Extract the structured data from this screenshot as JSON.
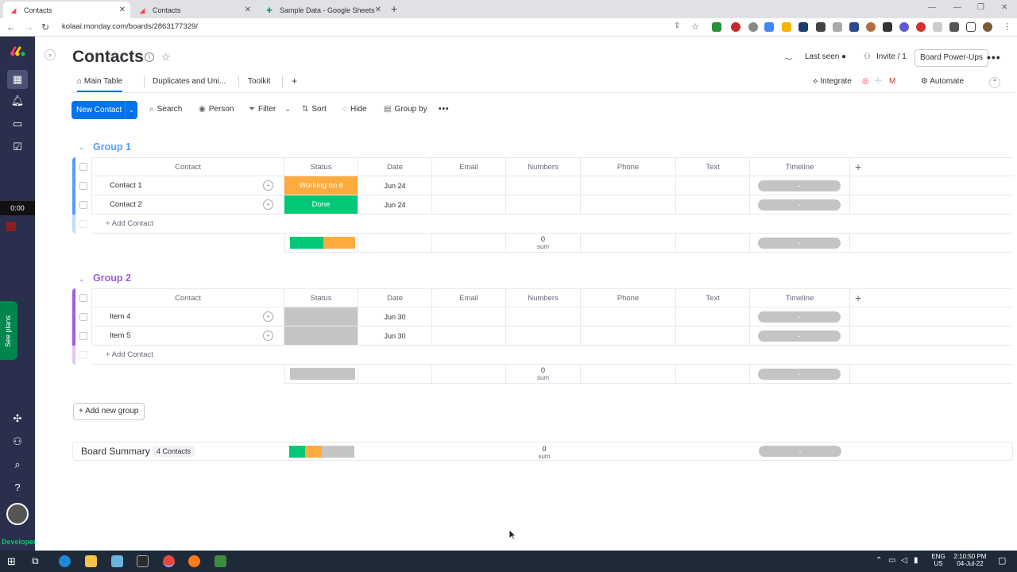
{
  "browser": {
    "tabs": [
      {
        "label": "Contacts",
        "active": true
      },
      {
        "label": "Contacts",
        "active": false
      },
      {
        "label": "Sample Data - Google Sheets",
        "active": false
      }
    ],
    "url": "kolaai.monday.com/boards/2863177329/"
  },
  "sidebar": {
    "timer": "0:00",
    "see_plans": "See plans",
    "developer": "Developer"
  },
  "board": {
    "title": "Contacts",
    "last_seen": "Last seen",
    "invite": "Invite / 1",
    "power_ups": "Board Power-Ups",
    "views": [
      "Main Table",
      "Duplicates and Uni...",
      "Toolkit"
    ],
    "add_view": "+",
    "integrate": "Integrate",
    "automate": "Automate"
  },
  "toolbar": {
    "new_item": "New Contact",
    "search": "Search",
    "person": "Person",
    "filter": "Filter",
    "sort": "Sort",
    "hide": "Hide",
    "group_by": "Group by"
  },
  "columns": [
    "Contact",
    "Status",
    "Date",
    "Email",
    "Numbers",
    "Phone",
    "Text",
    "Timeline"
  ],
  "groups": [
    {
      "title": "Group 1",
      "color": "#579bfc",
      "rows": [
        {
          "name": "Contact 1",
          "status": "Working on it",
          "date": "Jun 24",
          "timeline": "-"
        },
        {
          "name": "Contact 2",
          "status": "Done",
          "date": "Jun 24",
          "timeline": "-"
        }
      ],
      "add_label": "+ Add Contact",
      "numbers_sum": "0",
      "sum_label": "sum",
      "timeline_summary": "-"
    },
    {
      "title": "Group 2",
      "color": "#a25ddc",
      "rows": [
        {
          "name": "Item 4",
          "status": "",
          "date": "Jun 30",
          "timeline": "-"
        },
        {
          "name": "Item 5",
          "status": "",
          "date": "Jun 30",
          "timeline": "-"
        }
      ],
      "add_label": "+ Add Contact",
      "numbers_sum": "0",
      "sum_label": "sum",
      "timeline_summary": "-"
    }
  ],
  "add_group": "Add new group",
  "summary": {
    "label": "Board Summary",
    "count": "4 Contacts",
    "numbers_sum": "0",
    "sum_label": "sum",
    "timeline": "-"
  },
  "taskbar": {
    "lang1": "ENG",
    "lang2": "US",
    "time": "2:10:50 PM",
    "date": "04-Jul-22"
  },
  "colors": {
    "done": "#00c875",
    "working": "#fdab3d",
    "empty": "#c4c4c4",
    "primary": "#0073ea",
    "sidebar": "#292f4c"
  }
}
